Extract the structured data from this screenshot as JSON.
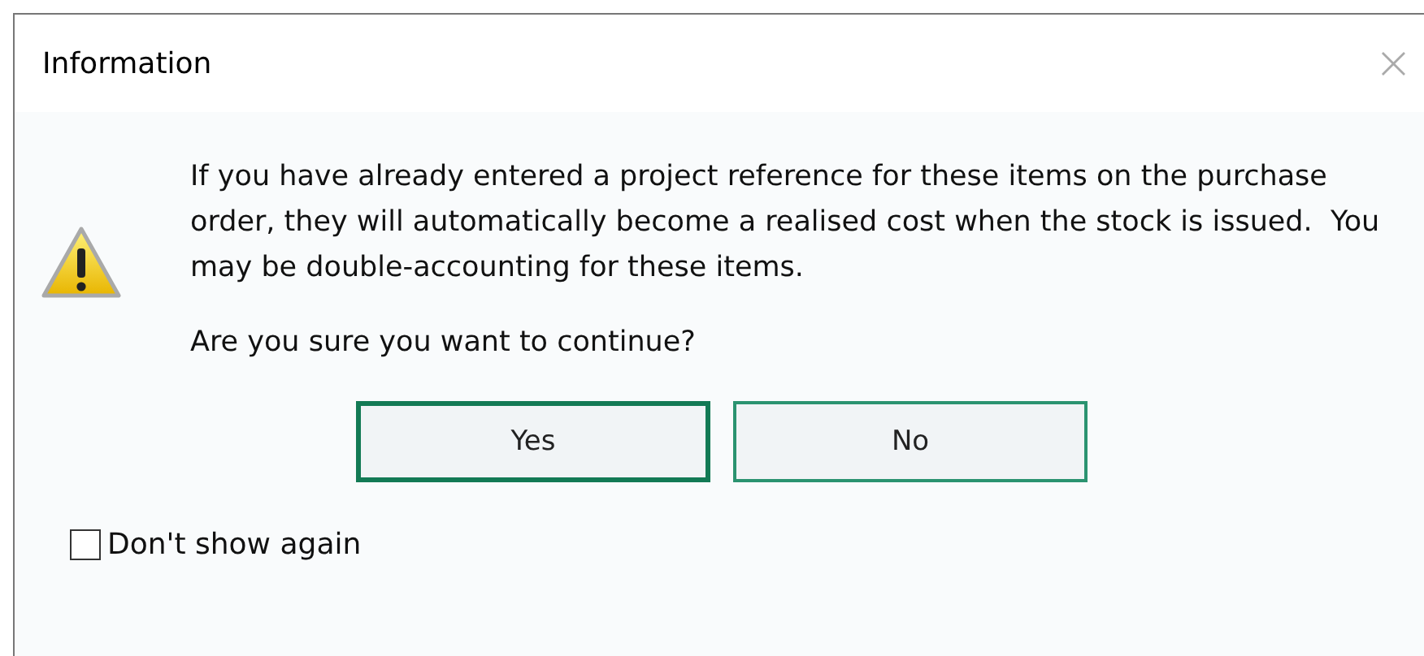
{
  "window": {
    "title": "Information",
    "close": "×"
  },
  "message": "If you have already entered a project reference for these items on the purchase order, they will automatically become a realised cost when the stock is issued.  You may be double-accounting for these items.",
  "question": "Are you sure you want to continue?",
  "buttons": [
    {
      "label": "Yes",
      "default": true
    },
    {
      "label": "No",
      "default": false
    }
  ],
  "dont_show_again": {
    "label": "Don't show again",
    "checked": false
  }
}
